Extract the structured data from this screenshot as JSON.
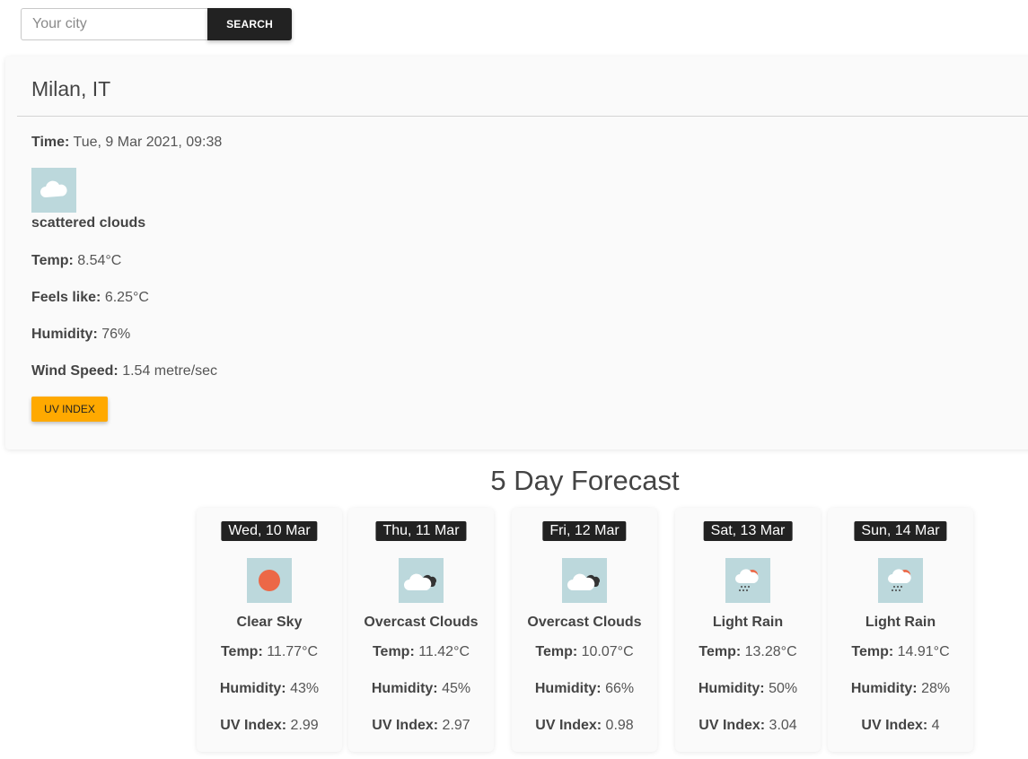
{
  "search": {
    "placeholder": "Your city",
    "button_label": "SEARCH"
  },
  "current": {
    "city": "Milan, IT",
    "time_label": "Time:",
    "time_value": "Tue, 9 Mar 2021, 09:38",
    "icon": "scattered-clouds-icon",
    "description": "scattered clouds",
    "temp_label": "Temp:",
    "temp_value": "8.54°C",
    "feels_label": "Feels like:",
    "feels_value": "6.25°C",
    "humidity_label": "Humidity:",
    "humidity_value": "76%",
    "wind_label": "Wind Speed:",
    "wind_value": "1.54 metre/sec",
    "uv_button": "UV INDEX"
  },
  "forecast": {
    "title": "5 Day Forecast",
    "temp_label": "Temp:",
    "humidity_label": "Humidity:",
    "uv_label": "UV Index:",
    "days": [
      {
        "date": "Wed, 10 Mar",
        "icon": "clear-sky-icon",
        "description": "Clear Sky",
        "temp": "11.77°C",
        "humidity": "43%",
        "uv": "2.99"
      },
      {
        "date": "Thu, 11 Mar",
        "icon": "overcast-clouds-icon",
        "description": "Overcast Clouds",
        "temp": "11.42°C",
        "humidity": "45%",
        "uv": "2.97"
      },
      {
        "date": "Fri, 12 Mar",
        "icon": "overcast-clouds-icon",
        "description": "Overcast Clouds",
        "temp": "10.07°C",
        "humidity": "66%",
        "uv": "0.98"
      },
      {
        "date": "Sat, 13 Mar",
        "icon": "light-rain-icon",
        "description": "Light Rain",
        "temp": "13.28°C",
        "humidity": "50%",
        "uv": "3.04"
      },
      {
        "date": "Sun, 14 Mar",
        "icon": "light-rain-icon",
        "description": "Light Rain",
        "temp": "14.91°C",
        "humidity": "28%",
        "uv": "4"
      }
    ]
  },
  "colors": {
    "accent": "#ffa900",
    "dark": "#222222",
    "icon_bg": "#bcd8dc",
    "sun": "#ec6847"
  }
}
